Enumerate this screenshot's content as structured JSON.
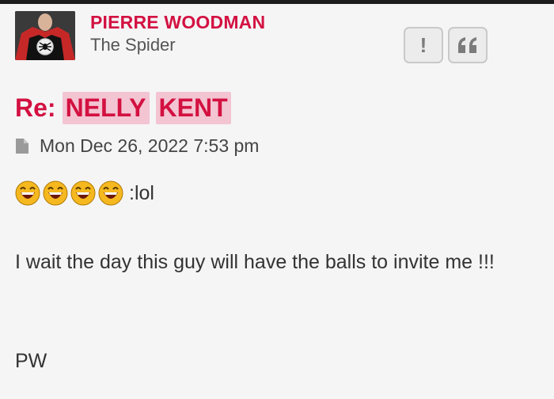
{
  "post": {
    "author": {
      "name": "PIERRE WOODMAN",
      "rank": "The Spider"
    },
    "title": {
      "prefix": "Re:",
      "highlight_1": "NELLY",
      "highlight_2": "KENT"
    },
    "timestamp": "Mon Dec 26, 2022 7:53 pm",
    "body": {
      "emoji_count": 4,
      "emoji_shortcode": ":lol",
      "paragraph_1": "I wait the day this guy will have the balls to invite me !!!",
      "signature": "PW"
    }
  },
  "actions": {
    "report_icon": "exclamation-icon",
    "quote_icon": "quote-icon"
  },
  "colors": {
    "author": "#d31141",
    "highlight_bg": "#f3c4d2",
    "background": "#f5f5f6"
  }
}
